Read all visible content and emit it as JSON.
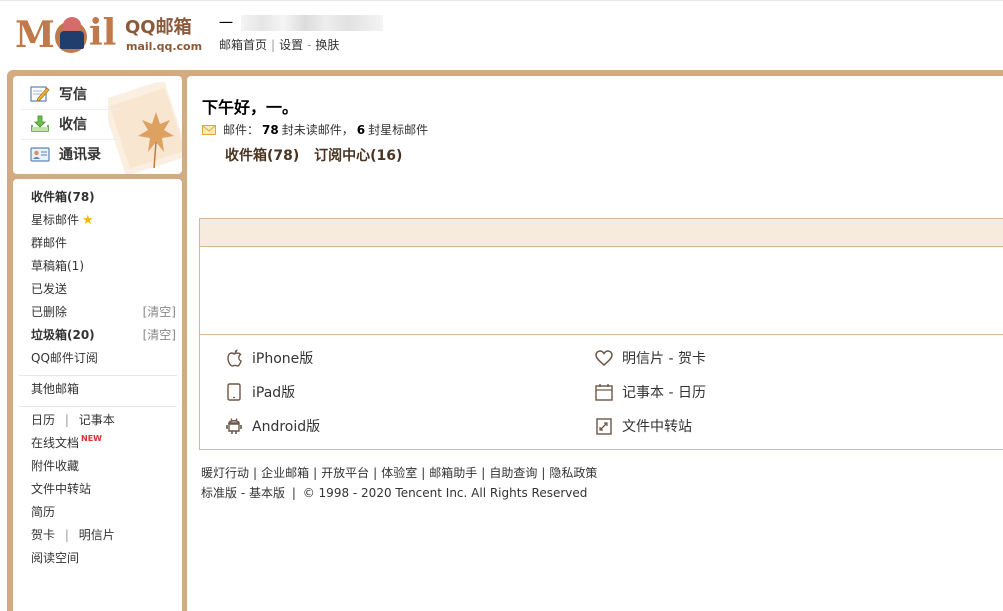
{
  "header": {
    "logo_text": "QQ邮箱",
    "logo_domain": "mail.qq.com",
    "user_name": "一",
    "links": [
      "邮箱首页",
      "设置",
      "换肤"
    ],
    "links_separators": [
      "|",
      "-"
    ]
  },
  "compose": {
    "write_label": "写信",
    "inbox_label": "收信",
    "contacts_label": "通讯录"
  },
  "folders": {
    "inbox": "收件箱(78)",
    "starred": "星标邮件",
    "group": "群邮件",
    "drafts": "草稿箱(1)",
    "sent": "已发送",
    "deleted": "已删除",
    "deleted_action": "[清空]",
    "spam": "垃圾箱(20)",
    "spam_action": "[清空]",
    "subscriptions": "QQ邮件订阅",
    "other_mailbox": "其他邮箱",
    "calendar": "日历",
    "notebook": "记事本",
    "pipe": "|",
    "online_docs": "在线文档",
    "new_badge": "NEW",
    "attachments": "附件收藏",
    "file_transfer": "文件中转站",
    "resume": "简历",
    "greeting_card": "贺卡",
    "postcard": "明信片",
    "reading_space": "阅读空间"
  },
  "main": {
    "greeting": "下午好，一。",
    "summary_prefix": "邮件：",
    "unread_count": "78",
    "unread_text": "封未读邮件，",
    "starred_count": "6",
    "starred_text": "封星标邮件",
    "quick_inbox": "收件箱(78)",
    "quick_subscribe": "订阅中心(16)"
  },
  "apps": {
    "iphone": "iPhone版",
    "ipad": "iPad版",
    "android": "Android版",
    "postcard": "明信片 - 贺卡",
    "notebook": "记事本 - 日历",
    "file_transfer": "文件中转站"
  },
  "footer": {
    "links": [
      "暖灯行动",
      "企业邮箱",
      "开放平台",
      "体验室",
      "邮箱助手",
      "自助查询",
      "隐私政策"
    ],
    "link_separator": "|",
    "version_standard": "标准版",
    "version_dash": "-",
    "version_basic": "基本版",
    "copyright_sep": "|",
    "copyright": "© 1998 - 2020 Tencent Inc. All Rights Reserved"
  },
  "colors": {
    "frame": "#d4aa82",
    "brand": "#c0794a",
    "panel_head": "#f7ebde",
    "panel_border": "#d8b898"
  },
  "icons": {
    "write": "pencil-note-icon",
    "inbox": "download-tray-icon",
    "contacts": "id-card-icon",
    "star": "star-icon",
    "envelope": "envelope-icon",
    "iphone": "apple-icon",
    "ipad": "tablet-icon",
    "android": "android-icon",
    "postcard": "heart-icon",
    "notebook": "calendar-icon",
    "file_transfer": "file-transfer-icon",
    "leaf": "maple-leaf-icon"
  }
}
